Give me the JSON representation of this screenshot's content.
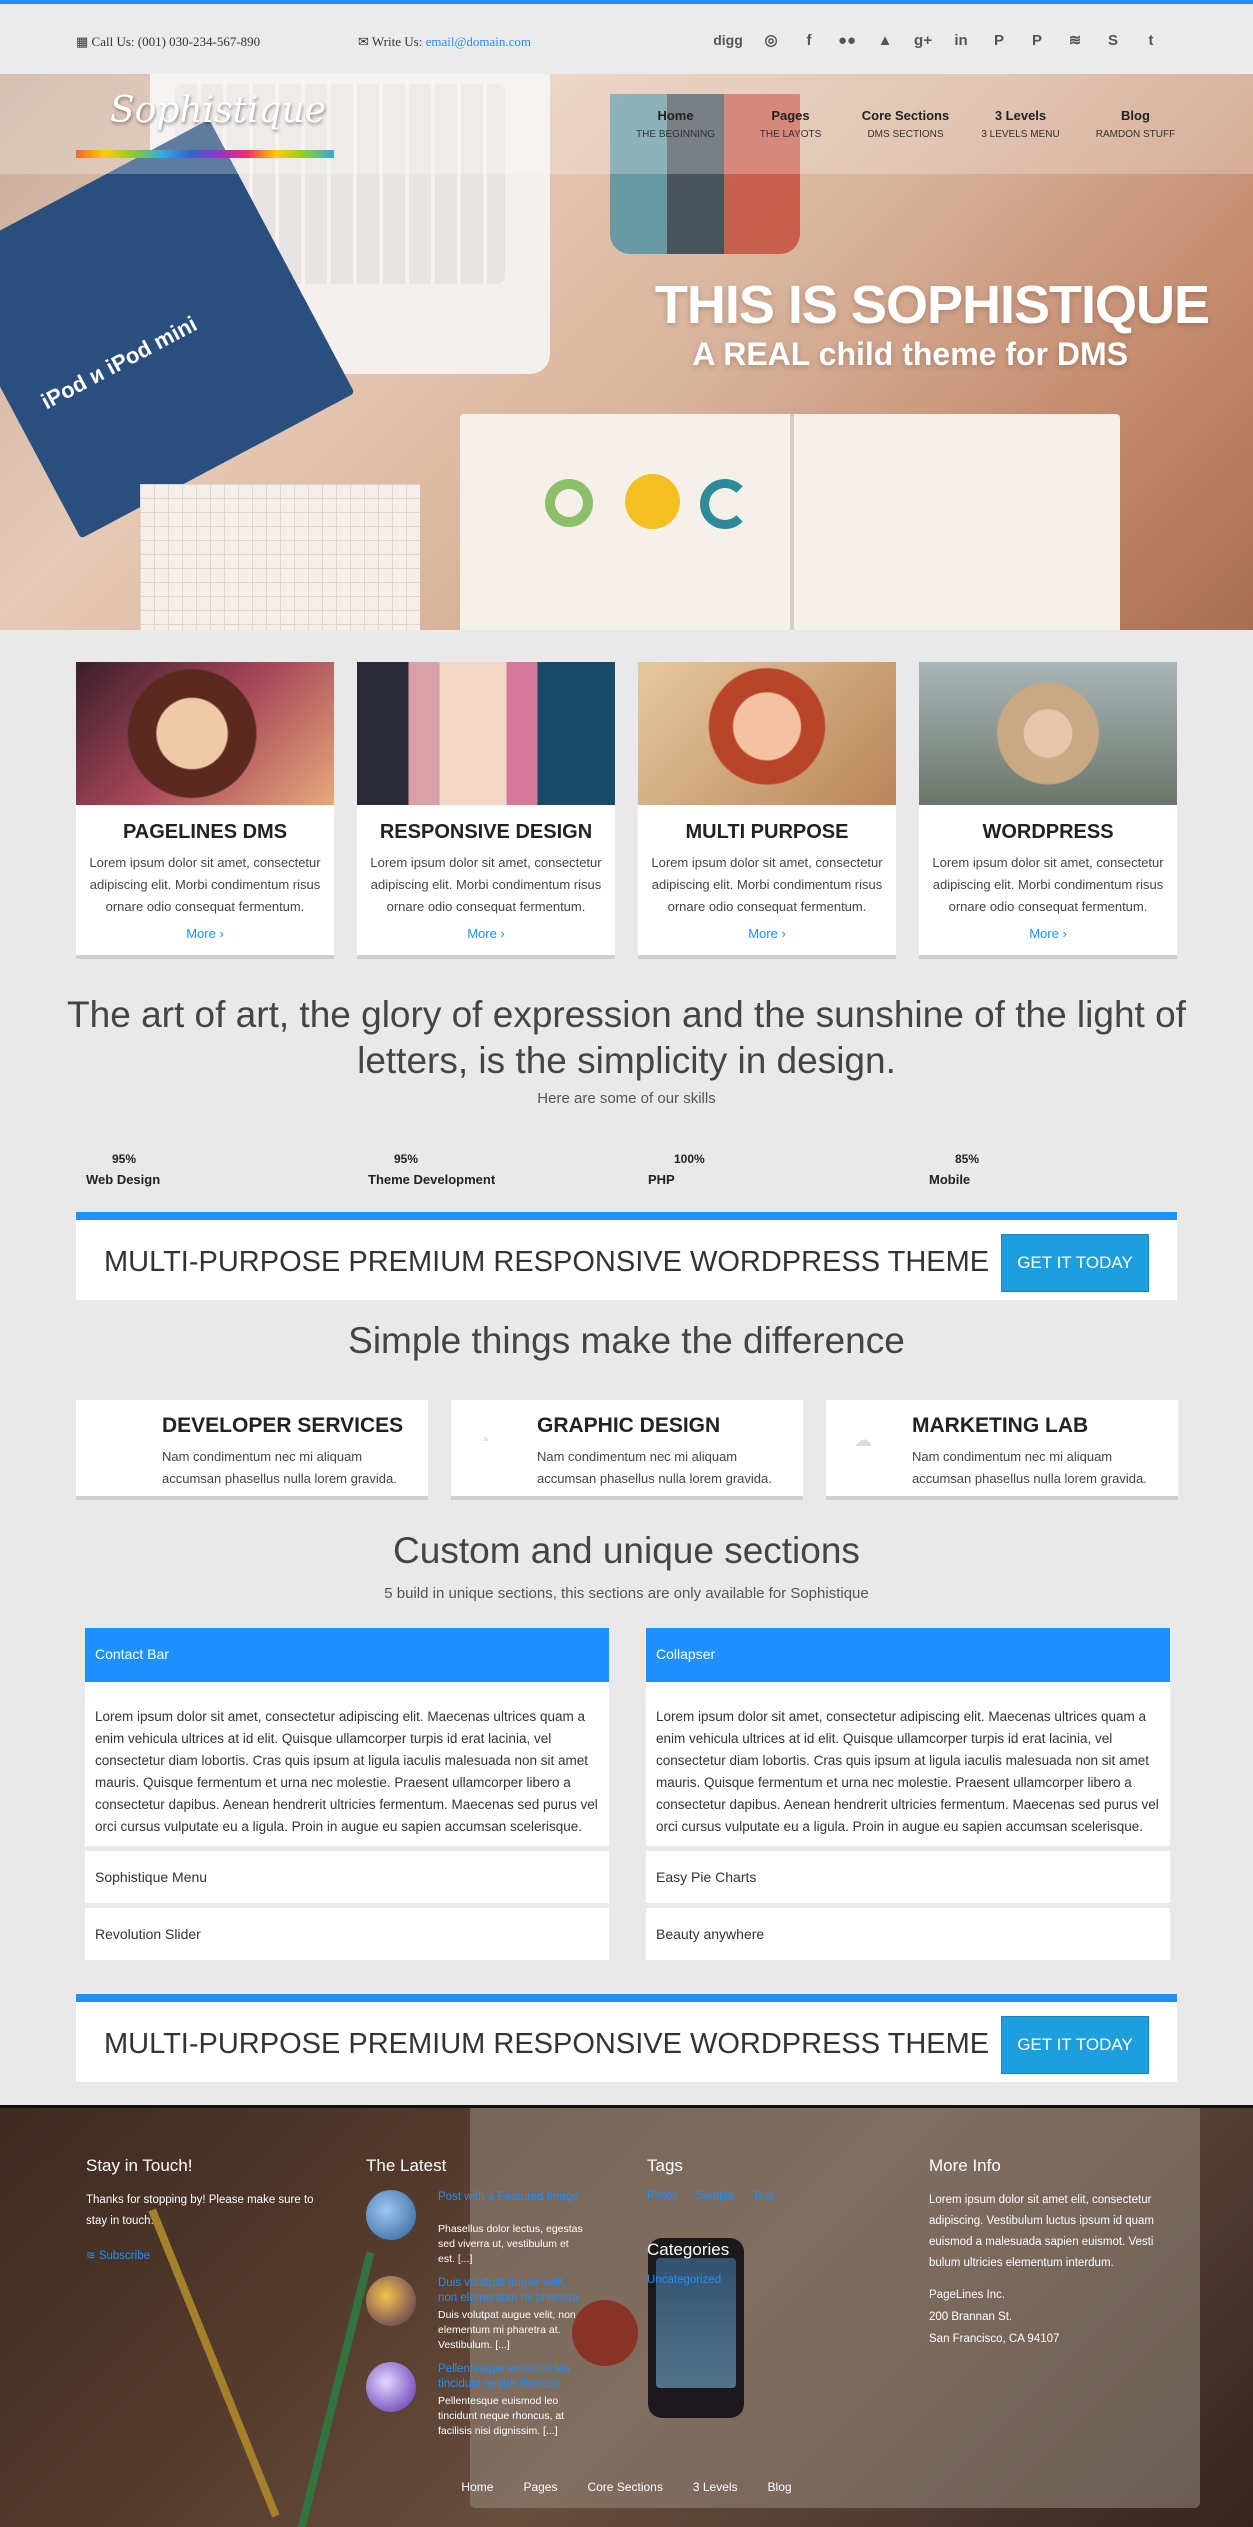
{
  "topbar": {
    "call_label": "Call Us: (001) 030-234-567-890",
    "write_label": "Write Us:",
    "email": "email@domain.com",
    "social": [
      {
        "icon": "digg-icon",
        "glyph": "digg"
      },
      {
        "icon": "dribbble-icon",
        "glyph": "◎"
      },
      {
        "icon": "facebook-icon",
        "glyph": "f"
      },
      {
        "icon": "flickr-icon",
        "glyph": "●●"
      },
      {
        "icon": "delicious-icon",
        "glyph": "▲"
      },
      {
        "icon": "google-plus-icon",
        "glyph": "g+"
      },
      {
        "icon": "linkedin-icon",
        "glyph": "in"
      },
      {
        "icon": "paypal-icon",
        "glyph": "P"
      },
      {
        "icon": "pinterest-icon",
        "glyph": "P"
      },
      {
        "icon": "rss-icon",
        "glyph": "≋"
      },
      {
        "icon": "skype-icon",
        "glyph": "S"
      },
      {
        "icon": "twitter-icon",
        "glyph": "t"
      }
    ]
  },
  "header": {
    "brand": "Sophistique",
    "nav": [
      {
        "title": "Home",
        "sub": "THE BEGINNING"
      },
      {
        "title": "Pages",
        "sub": "THE LAYOTS"
      },
      {
        "title": "Core Sections",
        "sub": "DMS SECTIONS"
      },
      {
        "title": "3 Levels",
        "sub": "3 LEVELS MENU"
      },
      {
        "title": "Blog",
        "sub": "RAMDON STUFF"
      }
    ]
  },
  "hero": {
    "title": "THIS IS SOPHISTIQUE",
    "subtitle": "A REAL child theme for DMS",
    "booklet_text": "iPod и iPod mini"
  },
  "cards": [
    {
      "title": "PAGELINES DMS",
      "text": "Lorem ipsum dolor sit amet, consectetur adipiscing elit. Morbi condimentum risus ornare odio consequat fermentum.",
      "more": "More ›"
    },
    {
      "title": "RESPONSIVE DESIGN",
      "text": "Lorem ipsum dolor sit amet, consectetur adipiscing elit. Morbi condimentum risus ornare odio consequat fermentum.",
      "more": "More ›"
    },
    {
      "title": "MULTI PURPOSE",
      "text": "Lorem ipsum dolor sit amet, consectetur adipiscing elit. Morbi condimentum risus ornare odio consequat fermentum.",
      "more": "More ›"
    },
    {
      "title": "WORDPRESS",
      "text": "Lorem ipsum dolor sit amet, consectetur adipiscing elit. Morbi condimentum risus ornare odio consequat fermentum.",
      "more": "More ›"
    }
  ],
  "quote": "The art of art, the glory of expression and the sunshine of the light of letters, is the simplicity in design.",
  "skills_sub": "Here are some of our skills",
  "skills": [
    {
      "pct": "95%",
      "name": "Web Design"
    },
    {
      "pct": "95%",
      "name": "Theme Development"
    },
    {
      "pct": "100%",
      "name": "PHP"
    },
    {
      "pct": "85%",
      "name": "Mobile"
    }
  ],
  "promo": {
    "text": "MULTI-PURPOSE PREMIUM RESPONSIVE WORDPRESS THEME",
    "button": "GET IT TODAY"
  },
  "simple_heading": "Simple things make the difference",
  "features": [
    {
      "icon": "code-icon",
      "title": "DEVELOPER SERVICES",
      "text": "Nam condimentum nec mi aliquam accumsan phasellus nulla lorem gravida."
    },
    {
      "icon": "lightbulb-icon",
      "title": "GRAPHIC DESIGN",
      "text": "Nam condimentum nec mi aliquam accumsan phasellus nulla lorem gravida."
    },
    {
      "icon": "cloud-icon",
      "title": "MARKETING LAB",
      "text": "Nam condimentum nec mi aliquam accumsan phasellus nulla lorem gravida."
    }
  ],
  "custom": {
    "heading": "Custom and unique sections",
    "sub": "5 build in unique sections, this sections are only available for Sophistique",
    "left": {
      "header": "Contact Bar",
      "body": "Lorem ipsum dolor sit amet, consectetur adipiscing elit. Maecenas ultrices quam a enim vehicula ultrices at id elit. Quisque ullamcorper turpis id erat lacinia, vel consectetur diam lobortis. Cras quis ipsum at ligula iaculis malesuada non sit amet mauris. Quisque fermentum et urna nec molestie. Praesent ullamcorper libero a consectetur dapibus. Aenean hendrerit ultricies fermentum. Maecenas sed purus vel orci cursus vulputate eu a ligula. Proin in augue eu sapien accumsan scelerisque.",
      "rows": [
        "Sophistique Menu",
        "Revolution Slider"
      ]
    },
    "right": {
      "header": "Collapser",
      "body": "Lorem ipsum dolor sit amet, consectetur adipiscing elit. Maecenas ultrices quam a enim vehicula ultrices at id elit. Quisque ullamcorper turpis id erat lacinia, vel consectetur diam lobortis. Cras quis ipsum at ligula iaculis malesuada non sit amet mauris. Quisque fermentum et urna nec molestie. Praesent ullamcorper libero a consectetur dapibus. Aenean hendrerit ultricies fermentum. Maecenas sed purus vel orci cursus vulputate eu a ligula. Proin in augue eu sapien accumsan scelerisque.",
      "rows": [
        "Easy Pie Charts",
        "Beauty anywhere"
      ]
    }
  },
  "footer": {
    "touch": {
      "title": "Stay in Touch!",
      "text": "Thanks for stopping by! Please make sure to stay in touch.",
      "subscribe": "Subscribe"
    },
    "latest": {
      "title": "The Latest",
      "posts": [
        {
          "title": "Post with a Featured Image",
          "text": "Phasellus dolor lectus, egestas sed viverra ut, vestibulum et est. [...]"
        },
        {
          "title": "Duis volutpat augue velit, non elementum mi pharetra",
          "text": "Duis volutpat augue velit, non elementum mi pharetra at. Vestibulum. [...]"
        },
        {
          "title": "Pellentesque euismod leo tincidunt neque rhoncus",
          "text": "Pellentesque euismod leo tincidunt neque rhoncus, at facilisis nisi dignissim. [...]"
        }
      ]
    },
    "tags": {
      "title": "Tags",
      "items": [
        "Photo",
        "Sample",
        "Test"
      ]
    },
    "categories": {
      "title": "Categories",
      "items": [
        "Uncategorized"
      ]
    },
    "info": {
      "title": "More Info",
      "text": "Lorem ipsum dolor sit amet elit, consectetur adipiscing. Vestibulum luctus ipsum id quam euismod a malesuada sapien euismot. Vesti bulum ultricies elementum interdum.",
      "addr1": "PageLines Inc.",
      "addr2": "200 Brannan St.",
      "addr3": "San Francisco, CA 94107"
    },
    "nav": [
      "Home",
      "Pages",
      "Core Sections",
      "3 Levels",
      "Blog"
    ]
  }
}
